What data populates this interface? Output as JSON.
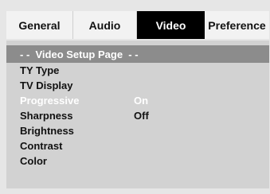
{
  "tabs": [
    {
      "label": "General",
      "active": false
    },
    {
      "label": "Audio",
      "active": false
    },
    {
      "label": "Video",
      "active": true
    },
    {
      "label": "Preference",
      "active": false
    }
  ],
  "page_header": "- -  Video Setup Page  - -",
  "rows": [
    {
      "label": "TY Type",
      "value": ""
    },
    {
      "label": "TV Display",
      "value": ""
    },
    {
      "label": "Progressive",
      "value": "On",
      "highlighted": true
    },
    {
      "label": "Sharpness",
      "value": "Off"
    },
    {
      "label": "Brightness",
      "value": ""
    },
    {
      "label": "Contrast",
      "value": ""
    },
    {
      "label": "Color",
      "value": ""
    }
  ],
  "colors": {
    "background": "#e6e6e6",
    "panel": "#d2d2d2",
    "header_bar": "#8c8c8c",
    "active_tab": "#000000",
    "inactive_tab": "#f2f2f2",
    "highlight_text": "#ffffff"
  }
}
